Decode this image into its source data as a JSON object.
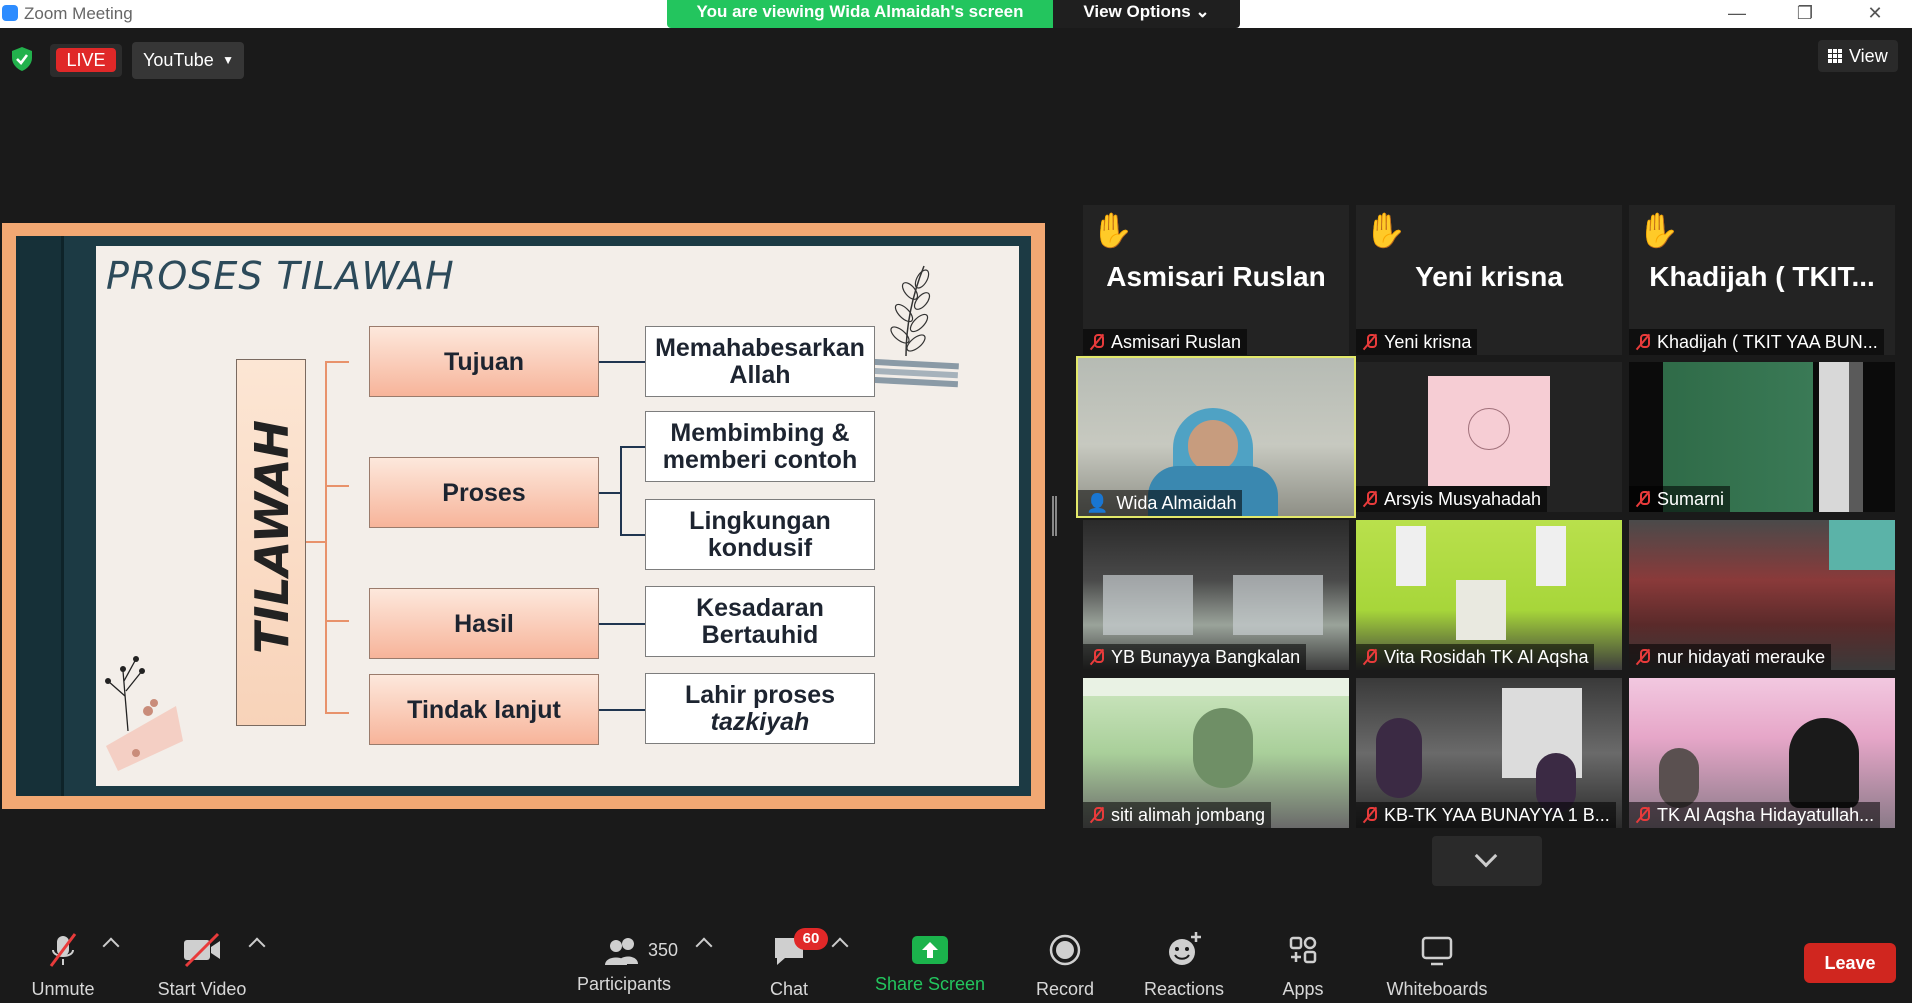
{
  "window": {
    "title": "Zoom Meeting",
    "viewing_banner": "You are viewing Wida Almaidah's screen",
    "view_options": "View Options"
  },
  "topbar": {
    "live_label": "LIVE",
    "stream_target": "YouTube",
    "view_label": "View"
  },
  "slide": {
    "title": "PROSES TILAWAH",
    "vertical_label": "TILAWAH",
    "left_boxes": [
      "Tujuan",
      "Proses",
      "Hasil",
      "Tindak lanjut"
    ],
    "right_boxes": [
      {
        "text": "Memahabesarkan\nAllah"
      },
      {
        "text": "Membimbing &\nmemberi contoh"
      },
      {
        "text": "Lingkungan\nkondusif"
      },
      {
        "text": "Kesadaran\nBertauhid"
      },
      {
        "text": "Lahir proses",
        "italic_line": "tazkiyah"
      }
    ]
  },
  "gallery": {
    "raised_hand": [
      {
        "display": "Asmisari Ruslan",
        "tag": "Asmisari Ruslan"
      },
      {
        "display": "Yeni krisna",
        "tag": "Yeni krisna"
      },
      {
        "display": "Khadijah ( TKIT...",
        "tag": "Khadijah ( TKIT YAA BUN..."
      }
    ],
    "row2": [
      "Wida Almaidah",
      "Arsyis Musyahadah",
      "Sumarni"
    ],
    "row3": [
      "YB Bunayya Bangkalan",
      "Vita Rosidah TK Al Aqsha",
      "nur hidayati merauke"
    ],
    "row4": [
      "siti alimah jombang",
      "KB-TK YAA BUNAYYA 1 B...",
      "TK Al Aqsha Hidayatullah..."
    ]
  },
  "toolbar": {
    "unmute": "Unmute",
    "start_video": "Start Video",
    "participants_count": "350",
    "participants": "Participants",
    "chat": "Chat",
    "chat_badge": "60",
    "share_screen": "Share Screen",
    "record": "Record",
    "reactions": "Reactions",
    "apps": "Apps",
    "whiteboards": "Whiteboards",
    "leave": "Leave"
  },
  "colors": {
    "banner_green": "#23c55e",
    "live_red": "#e02828",
    "leave_red": "#d0261f",
    "active_speaker": "#e3e96a"
  }
}
